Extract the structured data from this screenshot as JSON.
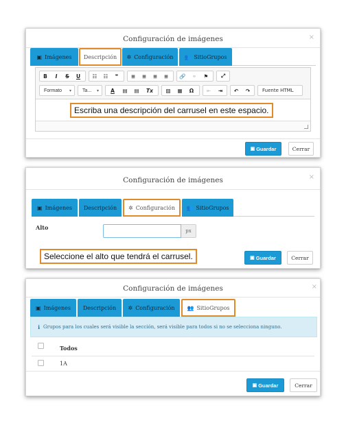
{
  "dialog1": {
    "title": "Configuración de imágenes",
    "close": "×",
    "tabs": [
      {
        "label": "Imágenes",
        "icon": "▣"
      },
      {
        "label": "Descripción",
        "icon": ""
      },
      {
        "label": "Configuración",
        "icon": "✲"
      },
      {
        "label": "SitioGrupos",
        "icon": "👥"
      }
    ],
    "toolbar": {
      "row1": [
        "B",
        "I",
        "S",
        "U",
        "☷",
        "☷",
        "❞",
        "≡",
        "≡",
        "≡",
        "≡",
        "🔗",
        "⚭",
        "⚑",
        "⤢"
      ],
      "row2": [
        "Formato",
        "Ta...",
        "A",
        "▤",
        "▤",
        "Tx",
        "▨",
        "▦",
        "Ω",
        "⇤",
        "⇥",
        "↶",
        "↷",
        "Fuente HTML"
      ]
    },
    "callout": "Escriba una descripción del carrusel en este espacio.",
    "save_label": "Guardar",
    "cancel_label": "Cerrar"
  },
  "dialog2": {
    "title": "Configuración de imágenes",
    "close": "×",
    "tabs": [
      {
        "label": "Imágenes",
        "icon": "▣"
      },
      {
        "label": "Descripción",
        "icon": ""
      },
      {
        "label": "Configuración",
        "icon": "✲"
      },
      {
        "label": "SitioGrupos",
        "icon": "👥"
      }
    ],
    "alto_label": "Alto",
    "alto_value": "",
    "unit": "px",
    "callout": "Seleccione el alto que tendrá el carrusel.",
    "save_label": "Guardar",
    "cancel_label": "Cerrar"
  },
  "dialog3": {
    "title": "Configuración de imágenes",
    "close": "×",
    "tabs": [
      {
        "label": "Imágenes",
        "icon": "▣"
      },
      {
        "label": "Descripción",
        "icon": ""
      },
      {
        "label": "Configuración",
        "icon": "✲"
      },
      {
        "label": "SitioGrupos",
        "icon": "👥"
      }
    ],
    "alert": "Grupos para los cuales será visible la sección, será visible para todos si no se selecciona ninguno.",
    "alert_icon": "ℹ",
    "header": "Todos",
    "rows": [
      "1A"
    ],
    "save_label": "Guardar",
    "cancel_label": "Cerrar"
  },
  "colors": {
    "accent": "#1b9ad6",
    "highlight": "#e2892a",
    "alert_bg": "#d9edf7"
  }
}
